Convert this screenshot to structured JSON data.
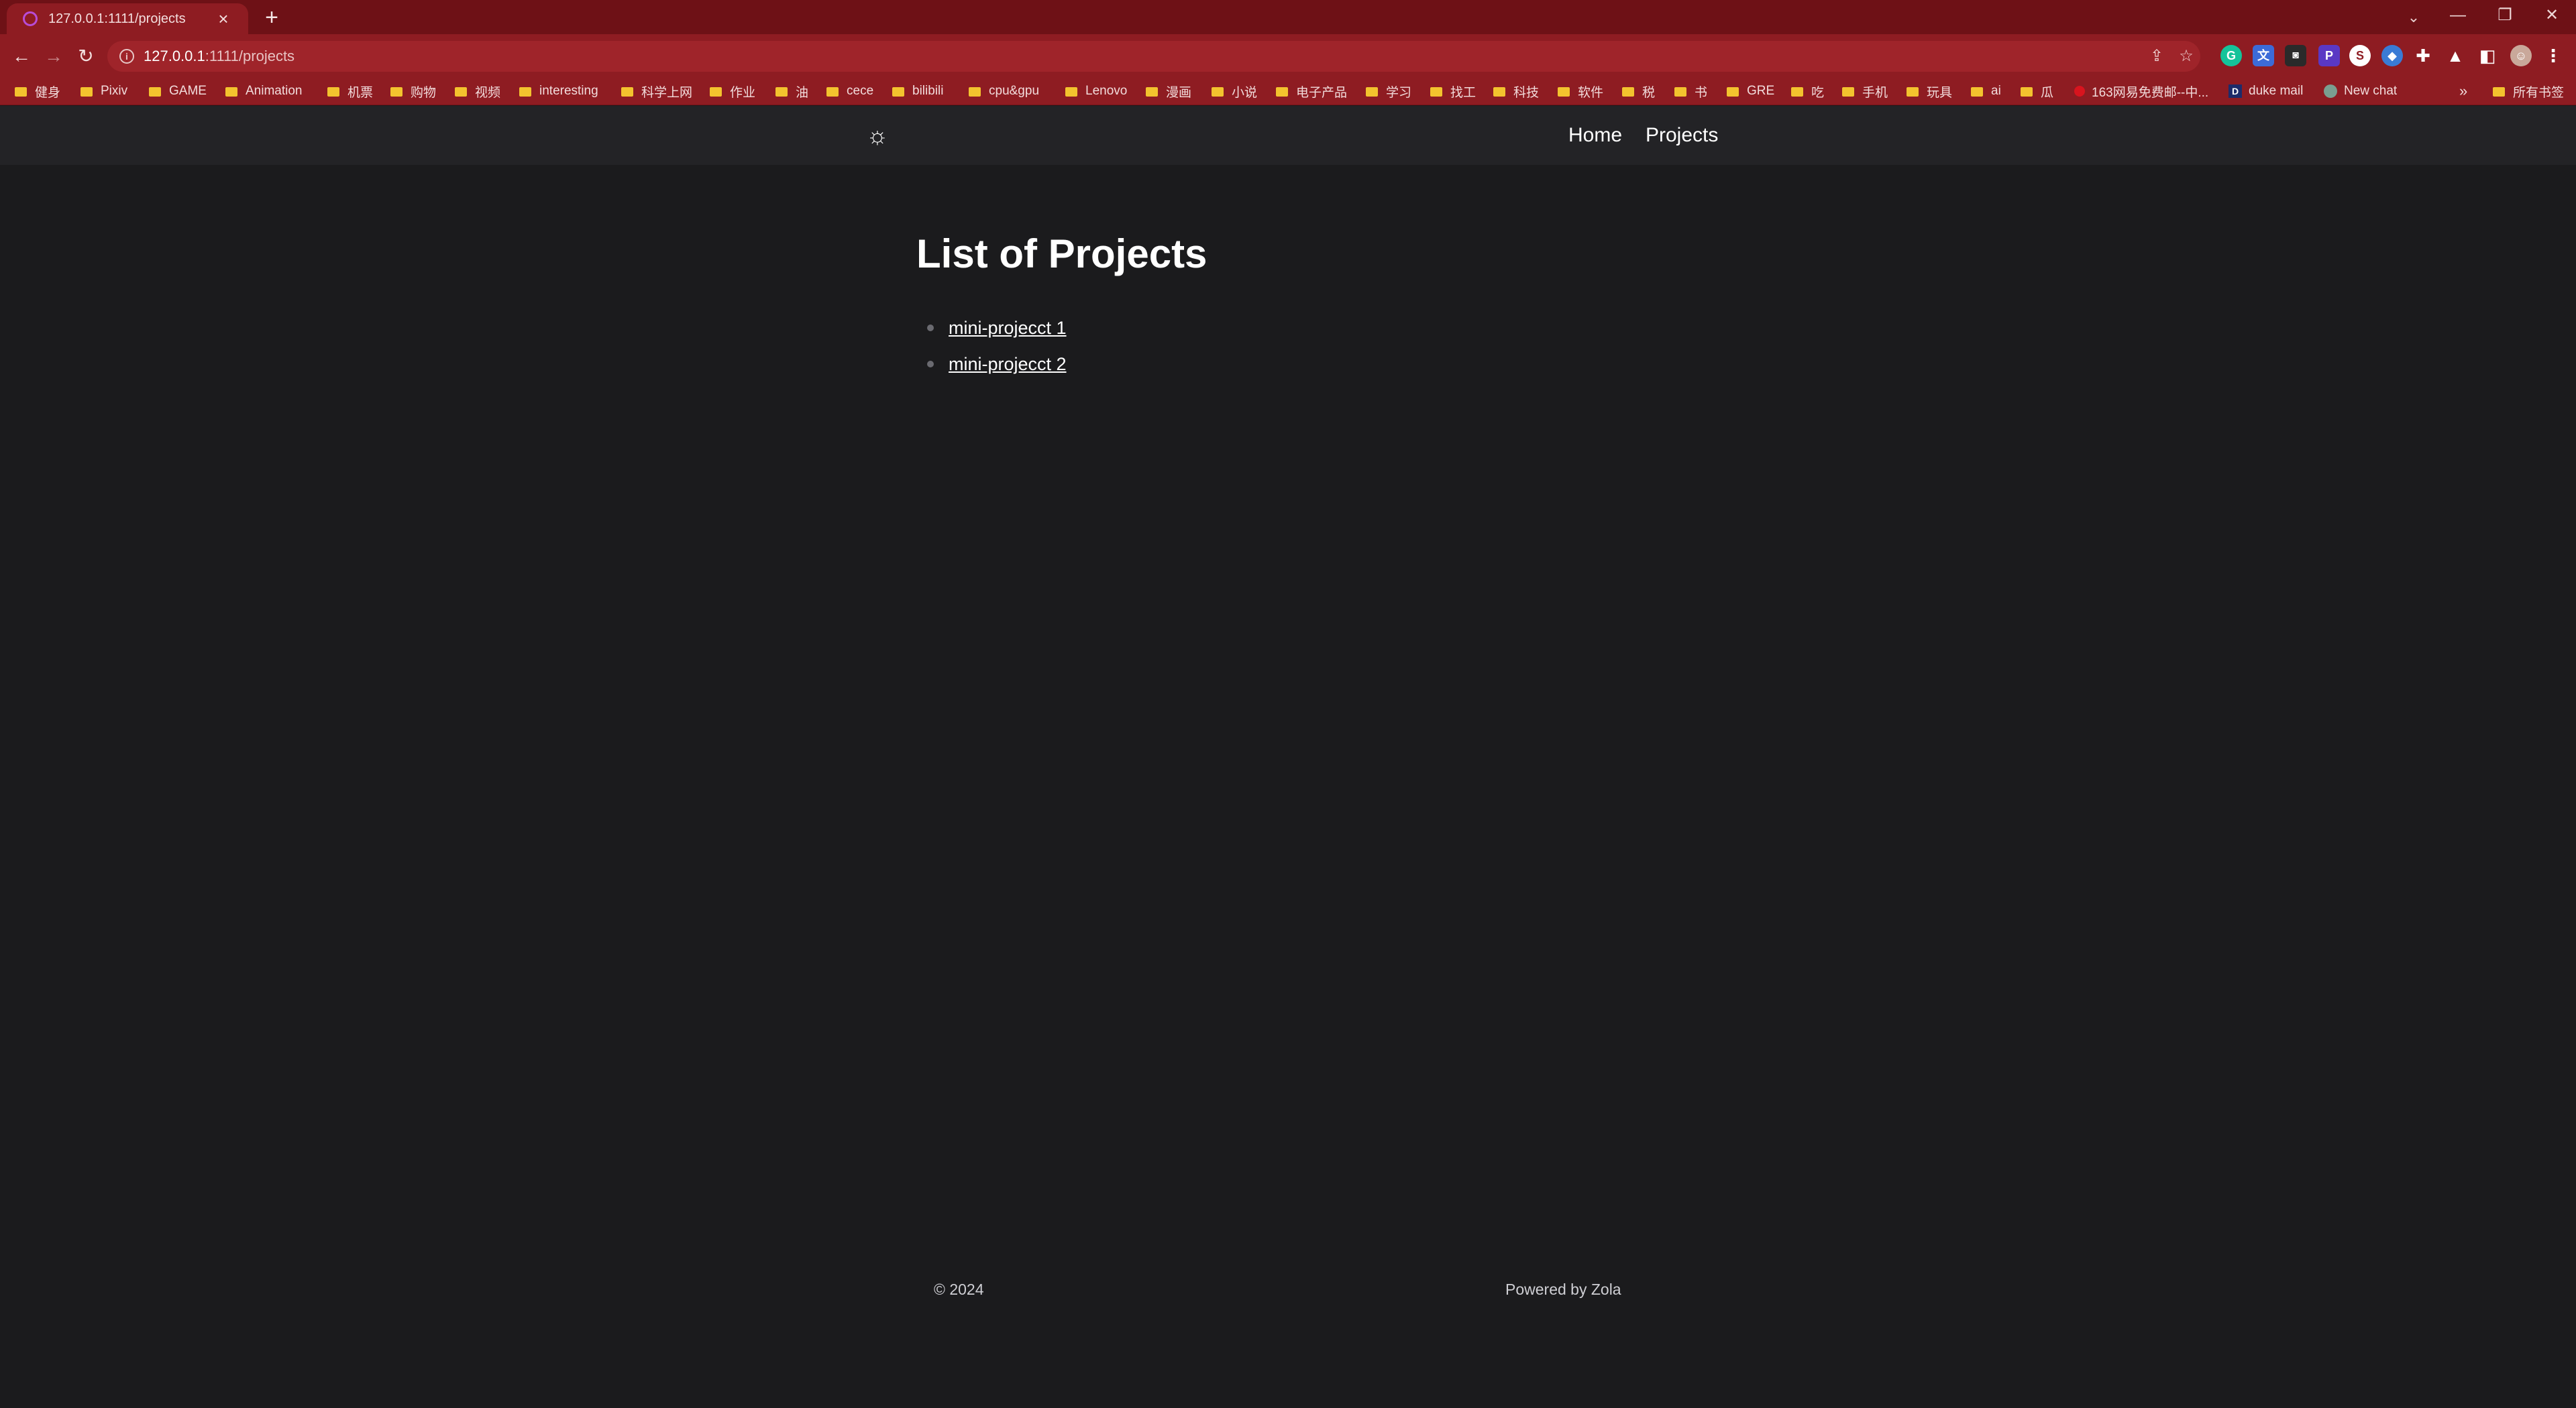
{
  "browser": {
    "tab": {
      "title": "127.0.0.1:1111/projects"
    },
    "url": {
      "host": "127.0.0.1",
      "path": ":1111/projects"
    },
    "bookmarks": [
      "健身",
      "Pixiv",
      "GAME",
      "Animation",
      "机票",
      "购物",
      "视频",
      "interesting",
      "科学上网",
      "作业",
      "油",
      "cece",
      "bilibili",
      "cpu&gpu",
      "Lenovo",
      "漫画",
      "小说",
      "电子产品",
      "学习",
      "找工",
      "科技",
      "软件",
      "税",
      "书",
      "GRE",
      "吃",
      "手机",
      "玩具",
      "ai",
      "瓜"
    ],
    "bookmark_special": {
      "mail163": "163网易免费邮--中...",
      "duke": "duke mail",
      "chat": "New chat",
      "overflow": "»",
      "all": "所有书签"
    },
    "extensions": {
      "grammarly": "G",
      "s": "S"
    }
  },
  "site": {
    "nav": {
      "home": "Home",
      "projects": "Projects"
    },
    "title": "List of Projects",
    "projects": [
      "mini-projecct 1",
      "mini-projecct 2"
    ],
    "footer": {
      "copyright": "© 2024",
      "powered": "Powered by Zola"
    }
  }
}
